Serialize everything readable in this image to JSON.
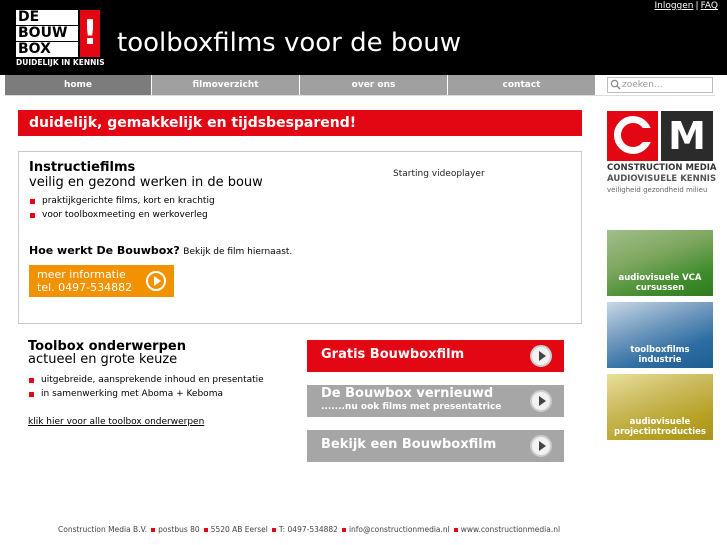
{
  "header": {
    "logo": {
      "line1": "DE",
      "line2": "BOUW",
      "line3": "BOX",
      "mark": "!",
      "tagline": "DUIDELIJK IN KENNIS"
    },
    "title": "toolboxfilms voor de bouw",
    "toplinks": {
      "login": "Inloggen",
      "separator": "|",
      "faq": "FAQ"
    }
  },
  "nav": {
    "items": [
      {
        "label": "home",
        "active": true
      },
      {
        "label": "filmoverzicht",
        "active": false
      },
      {
        "label": "over ons",
        "active": false
      },
      {
        "label": "contact",
        "active": false
      }
    ],
    "search": {
      "placeholder": "zoeken...",
      "icon": "search-icon"
    }
  },
  "banner": {
    "text": "duidelijk, gemakkelijk en tijdsbesparend!"
  },
  "instructie": {
    "title": "Instructiefilms",
    "subtitle": "veilig en gezond werken in de bouw",
    "bullets": [
      "praktijkgerichte films, kort en krachtig",
      "voor toolboxmeeting en werkoverleg"
    ],
    "player_text": "Starting videoplayer",
    "how_title": "Hoe werkt De Bouwbox?",
    "how_text": "Bekijk de film hiernaast.",
    "button": {
      "line1": "meer informatie",
      "line2": "tel. 0497-534882"
    }
  },
  "toolbox": {
    "title": "Toolbox onderwerpen",
    "subtitle": "actueel en grote keuze",
    "bullets": [
      "uitgebreide, aansprekende inhoud en presentatie",
      "in samenwerking met Aboma + Keboma"
    ],
    "link": "klik hier voor alle toolbox onderwerpen"
  },
  "ctas": {
    "gratis": "Gratis Bouwboxfilm",
    "vernieuwd": {
      "line1": "De Bouwbox vernieuwd",
      "line2": ".......nu ook films met presentatrice"
    },
    "bekijk": "Bekijk een Bouwboxfilm"
  },
  "sidebar": {
    "cm_logo": {
      "c": "C",
      "m": "M",
      "name": "CONSTRUCTION MEDIA",
      "kennis": "AUDIOVISUELE KENNIS",
      "values": "veiligheid gezondheid milieu"
    },
    "tiles": [
      {
        "line1": "audiovisuele VCA",
        "line2": "cursussen"
      },
      {
        "line1": "toolboxfilms",
        "line2": "industrie"
      },
      {
        "line1": "audiovisuele",
        "line2": "projectintroducties"
      }
    ]
  },
  "footer": {
    "company": "Construction Media B.V.",
    "postbus": "postbus 80",
    "address": "5520 AB Eersel",
    "phone": "T: 0497-534882",
    "email": "info@constructionmedia.nl",
    "web": "www.constructionmedia.nl"
  },
  "colors": {
    "brand_red": "#e30613",
    "orange": "#f39200",
    "nav_grey": "#a0a0a0",
    "header_black": "#000000"
  }
}
